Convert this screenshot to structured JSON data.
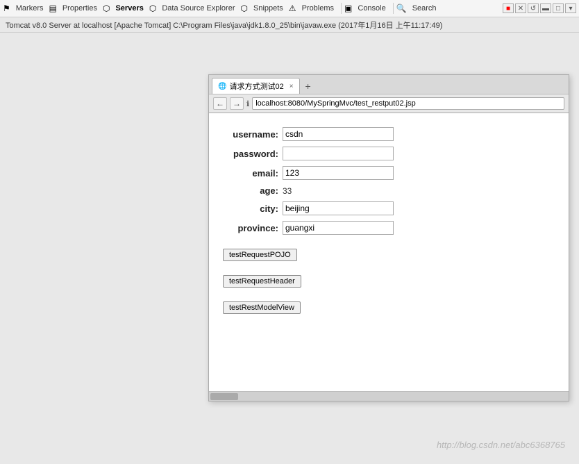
{
  "toolbar": {
    "tabs": [
      {
        "id": "markers",
        "label": "Markers",
        "icon": "⚑",
        "active": false
      },
      {
        "id": "properties",
        "label": "Properties",
        "icon": "▤",
        "active": false
      },
      {
        "id": "servers",
        "label": "Servers",
        "icon": "⬡",
        "active": true
      },
      {
        "id": "datasource",
        "label": "Data Source Explorer",
        "icon": "⬡",
        "active": false
      },
      {
        "id": "snippets",
        "label": "Snippets",
        "icon": "⬡",
        "active": false
      },
      {
        "id": "problems",
        "label": "Problems",
        "icon": "⚠",
        "active": false
      },
      {
        "id": "console",
        "label": "Console",
        "icon": "▣",
        "active": false
      },
      {
        "id": "search",
        "label": "Search",
        "icon": "🔍",
        "active": false
      }
    ],
    "search_label": "Search"
  },
  "status_bar": {
    "text": "Tomcat v8.0 Server at localhost [Apache Tomcat] C:\\Program Files\\java\\jdk1.8.0_25\\bin\\javaw.exe (2017年1月16日 上午11:17:49)"
  },
  "browser": {
    "tab_favicon": "🌐",
    "tab_label": "请求方式测试02",
    "tab_close": "×",
    "tab_new": "+",
    "nav_back": "←",
    "nav_forward": "→",
    "nav_info": "ℹ",
    "address": "localhost:8080/MySpringMvc/test_restput02.jsp",
    "form": {
      "fields": [
        {
          "label": "username:",
          "type": "input",
          "value": "csdn"
        },
        {
          "label": "password:",
          "type": "input",
          "value": ""
        },
        {
          "label": "email:",
          "type": "input",
          "value": "123"
        },
        {
          "label": "age:",
          "type": "text",
          "value": "33"
        },
        {
          "label": "city:",
          "type": "input",
          "value": "beijing"
        },
        {
          "label": "province:",
          "type": "input",
          "value": "guangxi"
        }
      ],
      "button1": "testRequestPOJO",
      "button2": "testRequestHeader",
      "button3": "testRestModelView"
    }
  },
  "watermark": {
    "text": "http://blog.csdn.net/abc6368765"
  },
  "eclipse_controls": {
    "close": "■",
    "min": "▬",
    "max": "□"
  }
}
